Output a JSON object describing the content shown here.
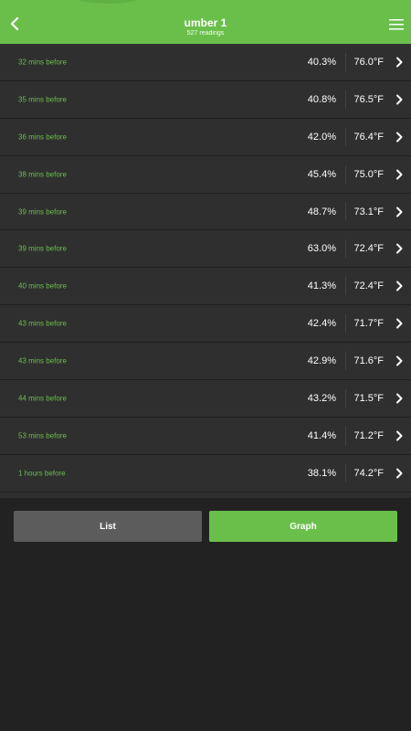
{
  "header": {
    "title": "umber 1",
    "subtitle": "527 readings",
    "accent_color": "#6abf4b",
    "back_icon": "chevron-left-icon",
    "menu_icon": "hamburger-menu-icon"
  },
  "readings": [
    {
      "time": "32 mins before",
      "humidity": "40.3%",
      "temperature": "76.0°F"
    },
    {
      "time": "35 mins before",
      "humidity": "40.8%",
      "temperature": "76.5°F"
    },
    {
      "time": "36 mins before",
      "humidity": "42.0%",
      "temperature": "76.4°F"
    },
    {
      "time": "38 mins before",
      "humidity": "45.4%",
      "temperature": "75.0°F"
    },
    {
      "time": "39 mins before",
      "humidity": "48.7%",
      "temperature": "73.1°F"
    },
    {
      "time": "39 mins before",
      "humidity": "63.0%",
      "temperature": "72.4°F"
    },
    {
      "time": "40 mins before",
      "humidity": "41.3%",
      "temperature": "72.4°F"
    },
    {
      "time": "43 mins before",
      "humidity": "42.4%",
      "temperature": "71.7°F"
    },
    {
      "time": "43 mins before",
      "humidity": "42.9%",
      "temperature": "71.6°F"
    },
    {
      "time": "44 mins before",
      "humidity": "43.2%",
      "temperature": "71.5°F"
    },
    {
      "time": "53 mins before",
      "humidity": "41.4%",
      "temperature": "71.2°F"
    },
    {
      "time": "1 hours before",
      "humidity": "38.1%",
      "temperature": "74.2°F"
    }
  ],
  "tabs": {
    "list_label": "List",
    "graph_label": "Graph",
    "active": "Graph"
  }
}
